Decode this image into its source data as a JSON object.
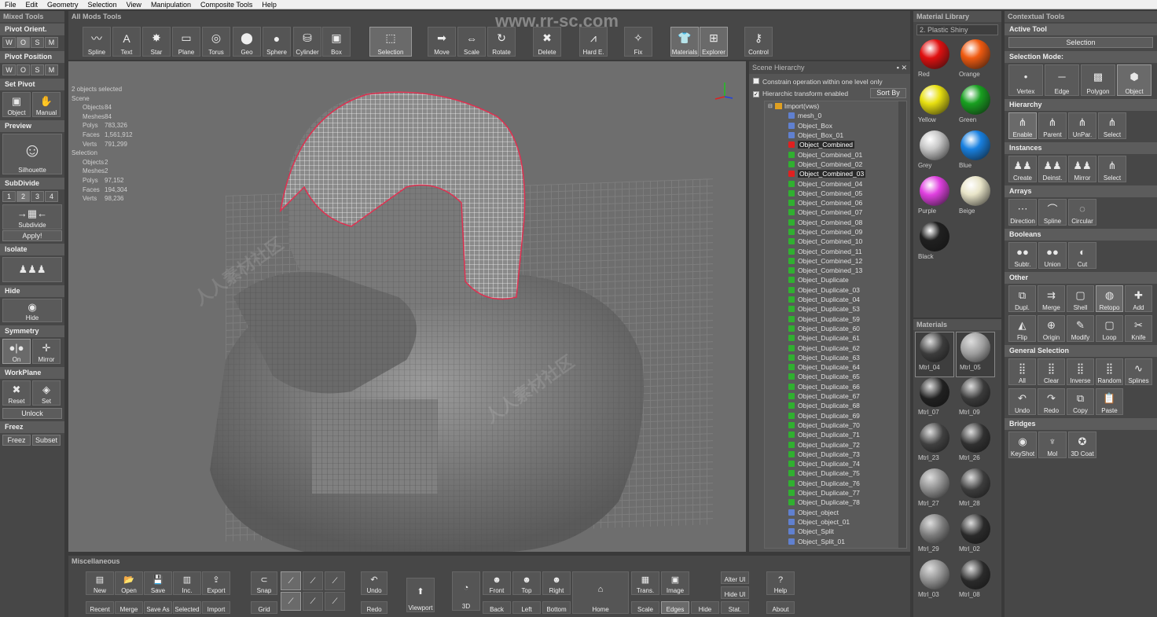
{
  "menu": [
    "File",
    "Edit",
    "Geometry",
    "Selection",
    "View",
    "Manipulation",
    "Composite Tools",
    "Help"
  ],
  "watermark_url": "www.rr-sc.com",
  "watermark_cn": "人人素材社区",
  "left": {
    "title": "Mixed Tools",
    "pivot_orient": {
      "label": "Pivot Orient.",
      "buttons": [
        "W",
        "O",
        "S",
        "M"
      ]
    },
    "pivot_position": {
      "label": "Pivot Position",
      "buttons": [
        "W",
        "O",
        "S",
        "M"
      ]
    },
    "set_pivot": {
      "label": "Set Pivot",
      "object": "Object",
      "manual": "Manual"
    },
    "preview": {
      "label": "Preview",
      "silhouette": "Silhouette"
    },
    "subdivide": {
      "label": "SubDivide",
      "levels": [
        "1",
        "2",
        "3",
        "4"
      ],
      "button": "Subdivide",
      "apply": "Apply!"
    },
    "isolate": {
      "label": "Isolate"
    },
    "hide": {
      "label": "Hide",
      "button": "Hide"
    },
    "symmetry": {
      "label": "Symmetry",
      "on": "On",
      "mirror": "Mirror"
    },
    "workplane": {
      "label": "WorkPlane",
      "reset": "Reset",
      "set": "Set",
      "unlock": "Unlock"
    },
    "freeze": {
      "label": "Freez",
      "freeze": "Freez",
      "subset": "Subset"
    }
  },
  "top": {
    "title": "All Mods Tools",
    "buttons": [
      "Spline",
      "Text",
      "Star",
      "Plane",
      "Torus",
      "Geo",
      "Sphere",
      "Cylinder",
      "Box",
      "Selection",
      "Move",
      "Scale",
      "Rotate",
      "Delete",
      "Hard E.",
      "Fix",
      "Materials",
      "Explorer",
      "Control"
    ]
  },
  "viewport": {
    "stats_header": "2 objects selected",
    "scene_label": "Scene",
    "scene": [
      [
        "Objects",
        "84"
      ],
      [
        "Meshes",
        "84"
      ],
      [
        "Polys",
        "783,326"
      ],
      [
        "Faces",
        "1,561,912"
      ],
      [
        "Verts",
        "791,299"
      ]
    ],
    "selection_label": "Selection",
    "selection": [
      [
        "Objects",
        "2"
      ],
      [
        "Meshes",
        "2"
      ],
      [
        "Polys",
        "97,152"
      ],
      [
        "Faces",
        "194,304"
      ],
      [
        "Verts",
        "98,236"
      ]
    ]
  },
  "hierarchy": {
    "title": "Scene Hierarchy",
    "opt1": "Constrain operation within one level only",
    "opt2": "Hierarchic transform enabled",
    "sort": "Sort By",
    "root": "Import(vws)",
    "items": [
      "mesh_0",
      "Object_Box",
      "Object_Box_01",
      "Object_Combined",
      "Object_Combined_01",
      "Object_Combined_02",
      "Object_Combined_03",
      "Object_Combined_04",
      "Object_Combined_05",
      "Object_Combined_06",
      "Object_Combined_07",
      "Object_Combined_08",
      "Object_Combined_09",
      "Object_Combined_10",
      "Object_Combined_11",
      "Object_Combined_12",
      "Object_Combined_13",
      "Object_Duplicate",
      "Object_Duplicate_03",
      "Object_Duplicate_04",
      "Object_Duplicate_53",
      "Object_Duplicate_59",
      "Object_Duplicate_60",
      "Object_Duplicate_61",
      "Object_Duplicate_62",
      "Object_Duplicate_63",
      "Object_Duplicate_64",
      "Object_Duplicate_65",
      "Object_Duplicate_66",
      "Object_Duplicate_67",
      "Object_Duplicate_68",
      "Object_Duplicate_69",
      "Object_Duplicate_70",
      "Object_Duplicate_71",
      "Object_Duplicate_72",
      "Object_Duplicate_73",
      "Object_Duplicate_74",
      "Object_Duplicate_75",
      "Object_Duplicate_76",
      "Object_Duplicate_77",
      "Object_Duplicate_78",
      "Object_object",
      "Object_object_01",
      "Object_Split",
      "Object_Split_01"
    ],
    "selected": [
      "Object_Combined",
      "Object_Combined_03"
    ]
  },
  "material_library": {
    "title": "Material Library",
    "preset": "2. Plastic Shiny",
    "swatches": [
      {
        "name": "Red",
        "color": "#e01010"
      },
      {
        "name": "Orange",
        "color": "#f05a10"
      },
      {
        "name": "Yellow",
        "color": "#e8e010"
      },
      {
        "name": "Green",
        "color": "#18a020"
      },
      {
        "name": "Grey",
        "color": "#c8c8c8"
      },
      {
        "name": "Blue",
        "color": "#1880e0"
      },
      {
        "name": "Purple",
        "color": "#e040e0"
      },
      {
        "name": "Beige",
        "color": "#e8e4c8"
      },
      {
        "name": "Black",
        "color": "#202020"
      }
    ]
  },
  "materials": {
    "title": "Materials",
    "items": [
      {
        "name": "Mtrl_04",
        "color": "#3c3c3c"
      },
      {
        "name": "Mtrl_05",
        "color": "#9c9c9c"
      },
      {
        "name": "Mtrl_07",
        "color": "#202020"
      },
      {
        "name": "Mtrl_09",
        "color": "#3a3a3a"
      },
      {
        "name": "Mtrl_23",
        "color": "#404040"
      },
      {
        "name": "Mtrl_26",
        "color": "#303030"
      },
      {
        "name": "Mtrl_27",
        "color": "#8a8a8a"
      },
      {
        "name": "Mtrl_28",
        "color": "#3c3c3c"
      },
      {
        "name": "Mtrl_29",
        "color": "#7a7a7a"
      },
      {
        "name": "Mtrl_02",
        "color": "#2a2a2a"
      },
      {
        "name": "Mtrl_03",
        "color": "#8c8c8c"
      },
      {
        "name": "Mtrl_08",
        "color": "#2a2a2a"
      }
    ]
  },
  "contextual": {
    "title": "Contextual Tools",
    "active_tool_label": "Active Tool",
    "active_tool": "Selection",
    "selection_mode_label": "Selection Mode:",
    "selection_mode": [
      "Vertex",
      "Edge",
      "Polygon",
      "Object"
    ],
    "hierarchy_label": "Hierarchy",
    "hierarchy": [
      "Enable",
      "Parent",
      "UnPar.",
      "Select"
    ],
    "instances_label": "Instances",
    "instances": [
      "Create",
      "Deinst.",
      "Mirror",
      "Select"
    ],
    "arrays_label": "Arrays",
    "arrays": [
      "Direction",
      "Spline",
      "Circular"
    ],
    "booleans_label": "Booleans",
    "booleans": [
      "Subtr.",
      "Union",
      "Cut"
    ],
    "other_label": "Other",
    "other1": [
      "Dupl.",
      "Merge",
      "Shell",
      "Retopo",
      "Add"
    ],
    "other2": [
      "Flip",
      "Origin",
      "Modify",
      "Loop",
      "Knife"
    ],
    "general_label": "General Selection",
    "general1": [
      "All",
      "Clear",
      "Inverse",
      "Random",
      "Splines"
    ],
    "general2": [
      "Undo",
      "Redo",
      "Copy",
      "Paste"
    ],
    "bridges_label": "Bridges",
    "bridges": [
      "KeyShot",
      "MoI",
      "3D Coat"
    ]
  },
  "bottom": {
    "title": "Miscellaneous",
    "file_top": [
      "New",
      "Open",
      "Save",
      "Inc.",
      "Export"
    ],
    "file_bottom": [
      "Recent",
      "Merge",
      "Save As",
      "Selected",
      "Import"
    ],
    "snap": "Snap",
    "grid": "Grid",
    "undo": "Undo",
    "redo": "Redo",
    "viewport": "Viewport",
    "view3d": "3D",
    "views_top": [
      "Front",
      "Top",
      "Right"
    ],
    "views_bottom": [
      "Back",
      "Left",
      "Bottom"
    ],
    "home": "Home",
    "trans": "Trans.",
    "image": "Image",
    "scale": "Scale",
    "edges": "Edges",
    "hide": "Hide",
    "alter_ui": "Alter UI",
    "hide_ui": "Hide UI",
    "stat": "Stat.",
    "help": "Help",
    "about": "About"
  }
}
